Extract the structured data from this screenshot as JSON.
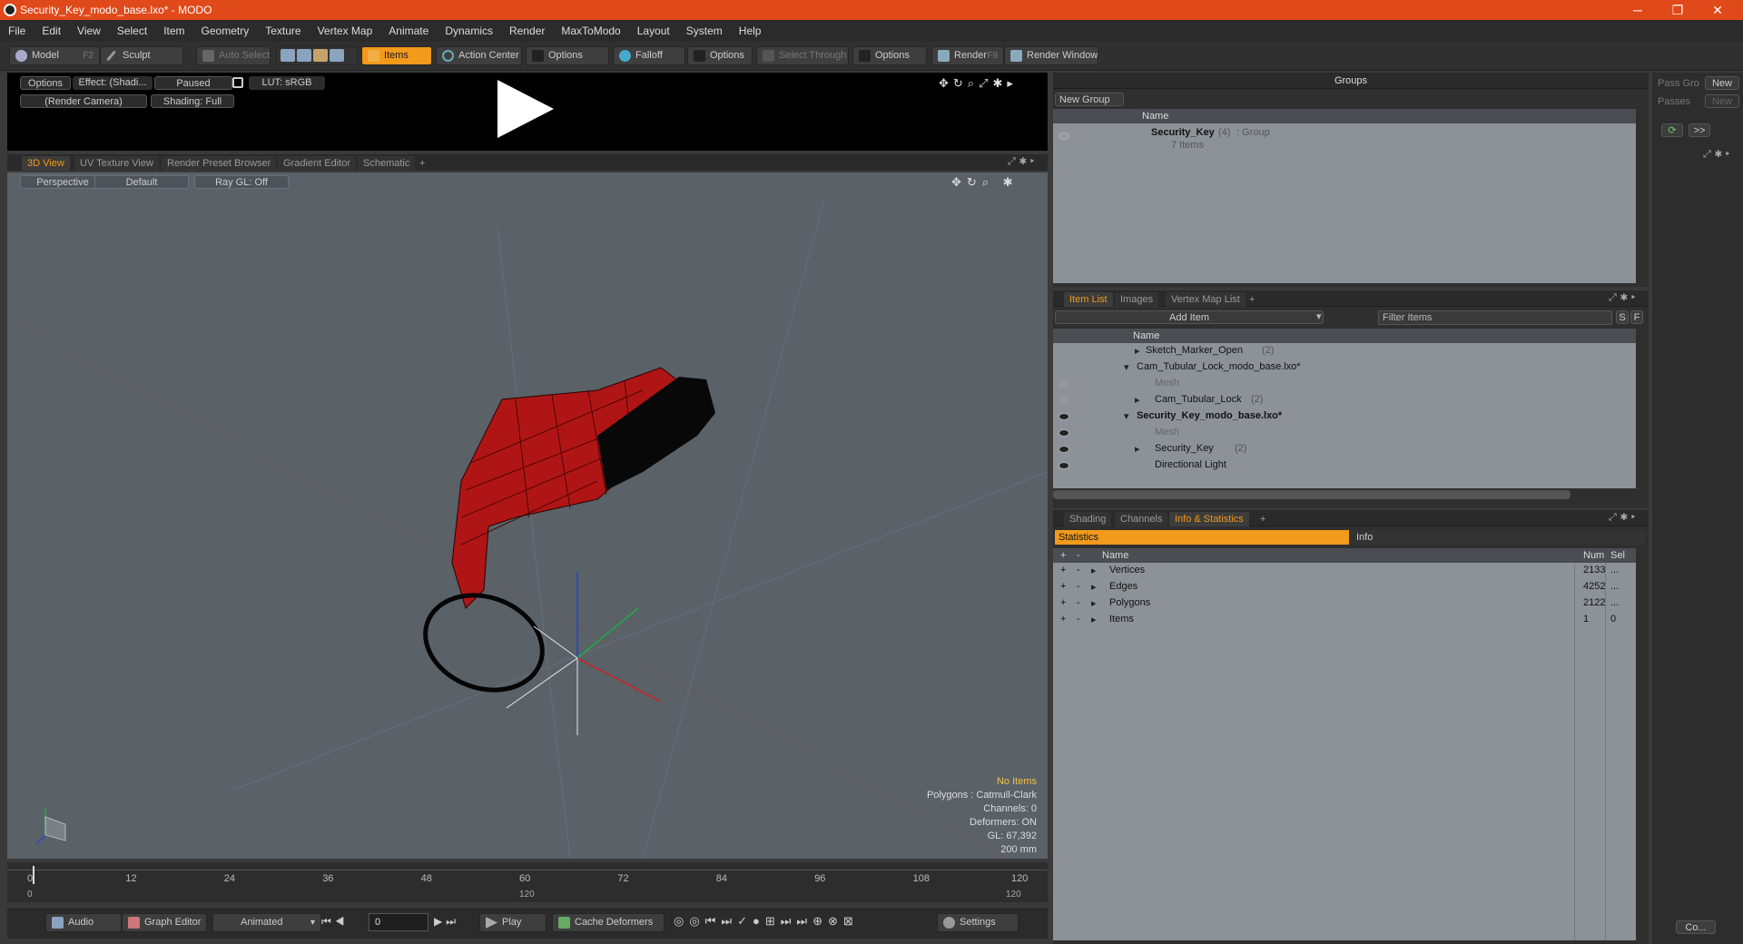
{
  "window": {
    "title": "Security_Key_modo_base.lxo* - MODO",
    "minimize": "─",
    "maximize": "❐",
    "close": "✕"
  },
  "menu": [
    "File",
    "Edit",
    "View",
    "Select",
    "Item",
    "Geometry",
    "Texture",
    "Vertex Map",
    "Animate",
    "Dynamics",
    "Render",
    "MaxToModo",
    "Layout",
    "System",
    "Help"
  ],
  "toolbar": {
    "model": "Model",
    "model_key": "F2",
    "sculpt": "Sculpt",
    "auto_select": "Auto Select",
    "items": "Items",
    "action_center": "Action Center",
    "options1": "Options",
    "falloff": "Falloff",
    "options2": "Options",
    "select_through": "Select Through",
    "options3": "Options",
    "render": "Render",
    "render_key": "F9",
    "render_window": "Render Window"
  },
  "preview": {
    "options": "Options",
    "effect": "Effect: (Shadi...",
    "paused": "Paused",
    "lut": "LUT: sRGB",
    "camera": "(Render Camera)",
    "shading": "Shading: Full"
  },
  "viewport_tabs": [
    "3D View",
    "UV Texture View",
    "Render Preset Browser",
    "Gradient Editor",
    "Schematic",
    "+"
  ],
  "viewport": {
    "perspective": "Perspective",
    "default": "Default",
    "raygl": "Ray GL: Off",
    "info": {
      "no_items": "No Items",
      "polygons": "Polygons : Catmull-Clark",
      "channels": "Channels: 0",
      "deformers": "Deformers: ON",
      "gl": "GL: 67,392",
      "size": "200 mm"
    }
  },
  "timeline": {
    "ticks": [
      "0",
      "12",
      "24",
      "36",
      "48",
      "60",
      "72",
      "84",
      "96",
      "108",
      "120"
    ],
    "start": "0",
    "mid": "120",
    "end": "120"
  },
  "bottombar": {
    "audio": "Audio",
    "graph_editor": "Graph Editor",
    "animated": "Animated",
    "frame": "0",
    "play": "Play",
    "cache": "Cache Deformers",
    "settings": "Settings"
  },
  "groups": {
    "title": "Groups",
    "new_group": "New Group",
    "col_name": "Name",
    "item_name": "Security_Key",
    "item_count": "(4)",
    "item_type": ": Group",
    "item_sub": "7 Items"
  },
  "right_strip": {
    "pass_group": "Pass Gro",
    "passes": "Passes",
    "new1": "New",
    "new2": "New",
    "more": ">>",
    "co": "Co..."
  },
  "itemlist": {
    "tabs": [
      "Item List",
      "Images",
      "Vertex Map List",
      "+"
    ],
    "add_item": "Add Item",
    "filter": "Filter Items",
    "s": "S",
    "f": "F",
    "col_name": "Name",
    "rows": [
      {
        "label": "Sketch_Marker_Open",
        "count": "(2)"
      },
      {
        "label": "Cam_Tubular_Lock_modo_base.lxo*",
        "count": ""
      },
      {
        "label": "Mesh",
        "count": ""
      },
      {
        "label": "Cam_Tubular_Lock",
        "count": "(2)"
      },
      {
        "label": "Security_Key_modo_base.lxo*",
        "count": ""
      },
      {
        "label": "Mesh",
        "count": ""
      },
      {
        "label": "Security_Key",
        "count": "(2)"
      },
      {
        "label": "Directional Light",
        "count": ""
      }
    ]
  },
  "stats": {
    "tabs": [
      "Shading",
      "Channels",
      "Info & Statistics",
      "+"
    ],
    "statistics": "Statistics",
    "info": "Info",
    "col_name": "Name",
    "col_num": "Num",
    "col_sel": "Sel",
    "rows": [
      {
        "name": "Vertices",
        "num": "2133",
        "sel": "..."
      },
      {
        "name": "Edges",
        "num": "4252",
        "sel": "..."
      },
      {
        "name": "Polygons",
        "num": "2122",
        "sel": "..."
      },
      {
        "name": "Items",
        "num": "1",
        "sel": "0"
      }
    ]
  },
  "colors": {
    "accent": "#f29a1b",
    "title": "#e0491a",
    "viewport": "#5a6167",
    "key": "#b01515"
  }
}
